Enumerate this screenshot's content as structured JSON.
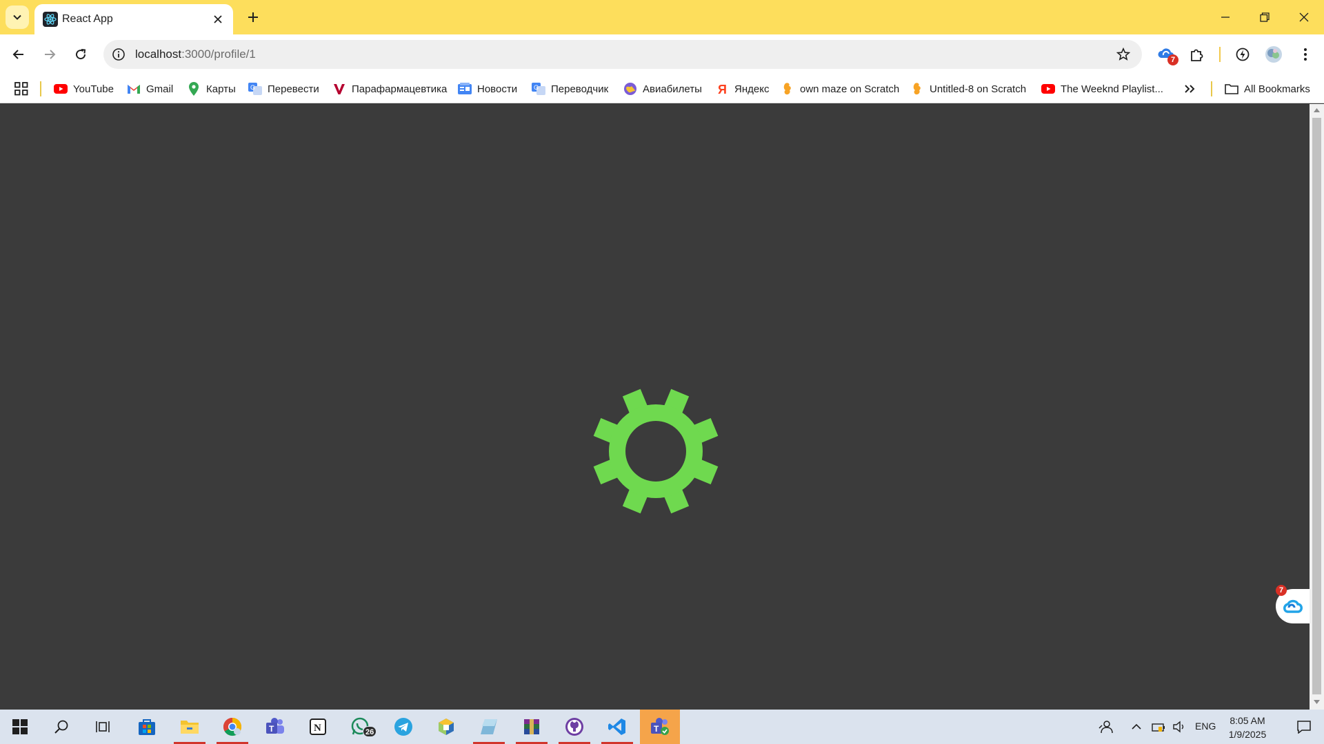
{
  "tab": {
    "title": "React App"
  },
  "address": {
    "host": "localhost",
    "path": ":3000/profile/1"
  },
  "toolbar": {
    "extension_badge": "7"
  },
  "bookmarks": [
    {
      "label": "YouTube",
      "icon": "youtube-icon",
      "color": "#ff0000"
    },
    {
      "label": "Gmail",
      "icon": "gmail-icon",
      "color": "#ea4335"
    },
    {
      "label": "Карты",
      "icon": "maps-icon",
      "color": "#34a853"
    },
    {
      "label": "Перевести",
      "icon": "translate-icon",
      "color": "#4285f4"
    },
    {
      "label": "Парафармацевтика",
      "icon": "v-logo-icon",
      "color": "#b5002f"
    },
    {
      "label": "Новости",
      "icon": "news-icon",
      "color": "#4285f4"
    },
    {
      "label": "Переводчик",
      "icon": "translate-icon",
      "color": "#4285f4"
    },
    {
      "label": "Авиабилеты",
      "icon": "globe-icon",
      "color": "#7b5cd6"
    },
    {
      "label": "Яндекс",
      "icon": "yandex-icon",
      "color": "#fc3f1d"
    },
    {
      "label": "own maze on Scratch",
      "icon": "scratch-icon",
      "color": "#f7a325"
    },
    {
      "label": "Untitled-8 on Scratch",
      "icon": "scratch-icon",
      "color": "#f7a325"
    },
    {
      "label": "The Weeknd Playlist...",
      "icon": "youtube-icon",
      "color": "#ff0000"
    }
  ],
  "all_bookmarks": "All Bookmarks",
  "page": {
    "gear_color": "#6fd94f",
    "background": "#3b3b3b"
  },
  "widget": {
    "badge": "7"
  },
  "taskbar": {
    "whatsapp_badge": "26",
    "language": "ENG",
    "time": "8:05 AM",
    "date": "1/9/2025"
  }
}
